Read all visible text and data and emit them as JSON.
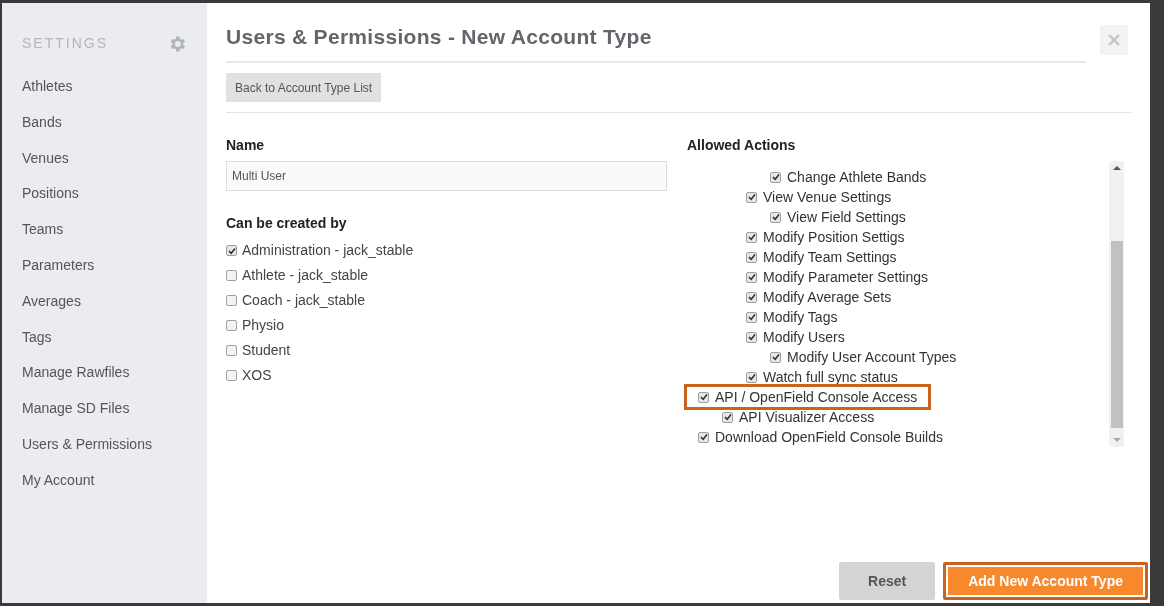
{
  "sidebar": {
    "heading": "SETTINGS",
    "items": [
      {
        "label": "Athletes",
        "selected": false
      },
      {
        "label": "Bands",
        "selected": false
      },
      {
        "label": "Venues",
        "selected": false
      },
      {
        "label": "Positions",
        "selected": false
      },
      {
        "label": "Teams",
        "selected": false
      },
      {
        "label": "Parameters",
        "selected": false
      },
      {
        "label": "Averages",
        "selected": false
      },
      {
        "label": "Tags",
        "selected": false
      },
      {
        "label": "Manage Rawfiles",
        "selected": false
      },
      {
        "label": "Manage SD Files",
        "selected": false
      },
      {
        "label": "Users & Permissions",
        "selected": false
      },
      {
        "label": "My Account",
        "selected": false
      }
    ]
  },
  "dialog": {
    "title": "Users & Permissions - New Account Type",
    "back_button": "Back to Account Type List",
    "name_field": {
      "label": "Name",
      "value": "Multi User"
    },
    "created_by": {
      "label": "Can be created by",
      "options": [
        {
          "label": "Administration - jack_stable",
          "checked": true
        },
        {
          "label": "Athlete - jack_stable",
          "checked": false
        },
        {
          "label": "Coach - jack_stable",
          "checked": false
        },
        {
          "label": "Physio",
          "checked": false
        },
        {
          "label": "Student",
          "checked": false
        },
        {
          "label": "XOS",
          "checked": false
        }
      ]
    },
    "allowed_actions": {
      "label": "Allowed Actions",
      "items": [
        {
          "kind": "group",
          "children": [
            {
              "kind": "group",
              "children": [
                {
                  "kind": "group",
                  "children": [
                    {
                      "kind": "action",
                      "label": "Change Athlete Bands",
                      "checked": true,
                      "highlighted": false
                    }
                  ]
                },
                {
                  "kind": "action",
                  "label": "View Venue Settings",
                  "checked": true,
                  "highlighted": false,
                  "children": [
                    {
                      "kind": "action",
                      "label": "View Field Settings",
                      "checked": true,
                      "highlighted": false
                    }
                  ]
                },
                {
                  "kind": "action",
                  "label": "Modify Position Settigs",
                  "checked": true,
                  "highlighted": false
                },
                {
                  "kind": "action",
                  "label": "Modify Team Settings",
                  "checked": true,
                  "highlighted": false
                },
                {
                  "kind": "action",
                  "label": "Modify Parameter Settings",
                  "checked": true,
                  "highlighted": false
                },
                {
                  "kind": "action",
                  "label": "Modify Average Sets",
                  "checked": true,
                  "highlighted": false
                },
                {
                  "kind": "action",
                  "label": "Modify Tags",
                  "checked": true,
                  "highlighted": false
                },
                {
                  "kind": "action",
                  "label": "Modify Users",
                  "checked": true,
                  "highlighted": false,
                  "children": [
                    {
                      "kind": "action",
                      "label": "Modify User Account Types",
                      "checked": true,
                      "highlighted": false
                    }
                  ]
                },
                {
                  "kind": "action",
                  "label": "Watch full sync status",
                  "checked": true,
                  "highlighted": false
                }
              ]
            }
          ]
        },
        {
          "kind": "action",
          "label": "API / OpenField Console Access",
          "checked": true,
          "highlighted": true,
          "children": [
            {
              "kind": "action",
              "label": "API Visualizer Access",
              "checked": true,
              "highlighted": false
            }
          ]
        },
        {
          "kind": "action",
          "label": "Download OpenField Console Builds",
          "checked": true,
          "highlighted": false
        }
      ]
    },
    "buttons": [
      {
        "label": "Reset",
        "kind": "secondary",
        "highlighted": false
      },
      {
        "label": "Add New Account Type",
        "kind": "primary",
        "highlighted": true
      }
    ]
  }
}
